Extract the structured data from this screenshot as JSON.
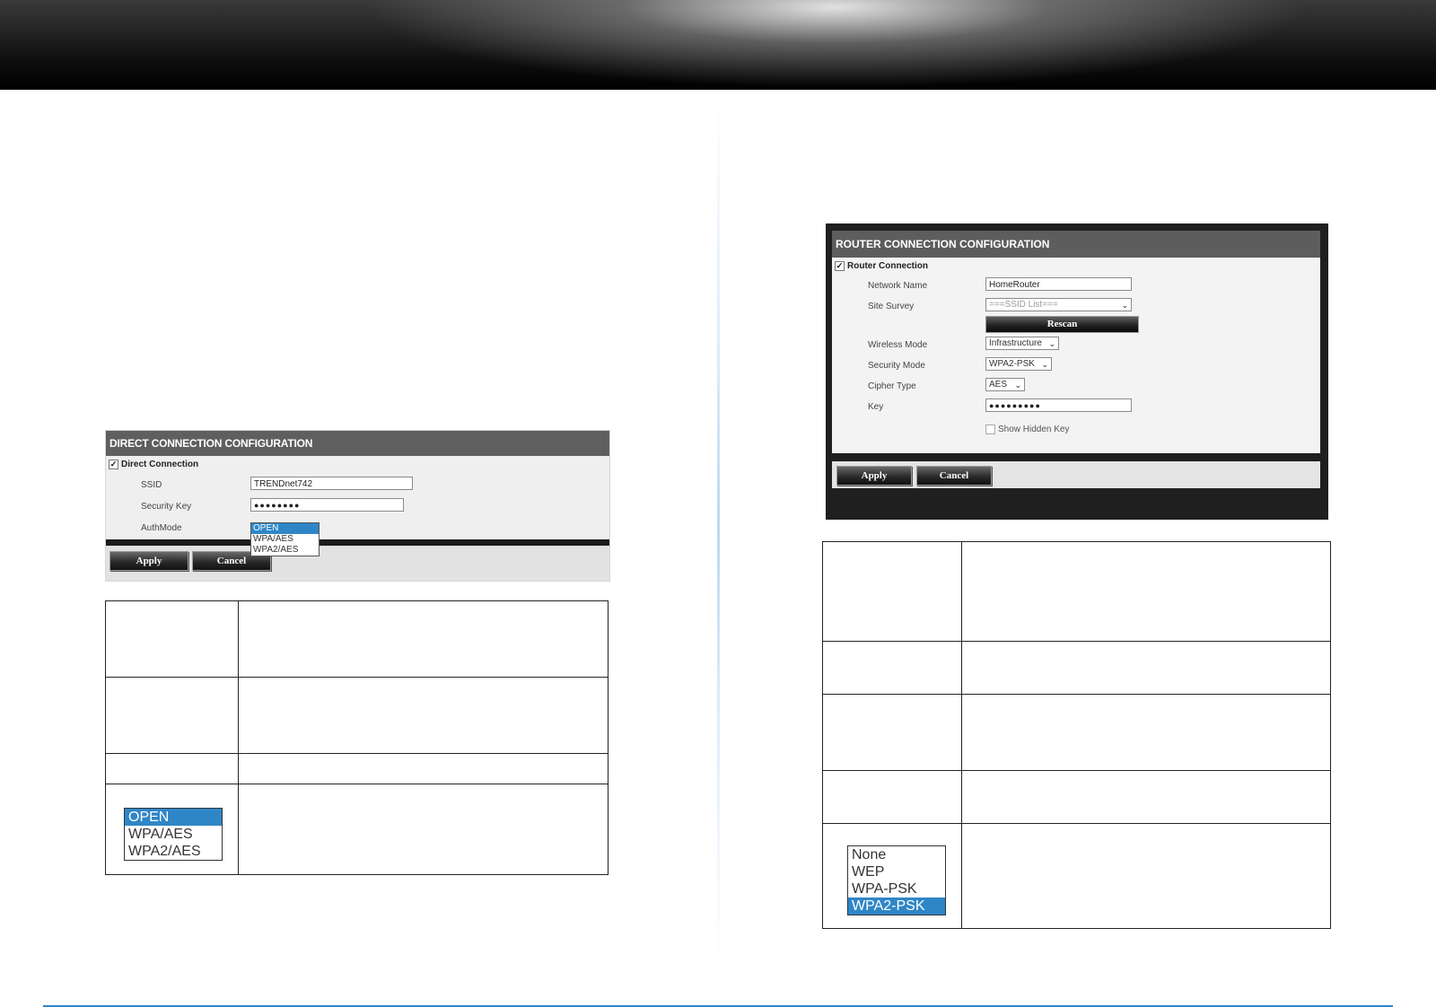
{
  "direct": {
    "title": "DIRECT CONNECTION CONFIGURATION",
    "checkbox_label": "Direct Connection",
    "checkbox_mark": "✓",
    "ssid_label": "SSID",
    "ssid_value": "TRENDnet742",
    "security_key_label": "Security Key",
    "security_key_value": "●●●●●●●●",
    "authmode_label": "AuthMode",
    "authmode_options": [
      "OPEN",
      "WPA/AES",
      "WPA2/AES"
    ],
    "authmode_selected": "OPEN",
    "apply_label": "Apply",
    "cancel_label": "Cancel"
  },
  "router": {
    "title": "ROUTER CONNECTION CONFIGURATION",
    "checkbox_label": "Router Connection",
    "checkbox_mark": "✓",
    "network_name_label": "Network Name",
    "network_name_value": "HomeRouter",
    "site_survey_label": "Site Survey",
    "site_survey_value": "===SSID List===",
    "rescan_label": "Rescan",
    "wireless_mode_label": "Wireless Mode",
    "wireless_mode_value": "Infrastructure",
    "security_mode_label": "Security Mode",
    "security_mode_value": "WPA2-PSK",
    "cipher_type_label": "Cipher Type",
    "cipher_type_value": "AES",
    "key_label": "Key",
    "key_value": "●●●●●●●●●",
    "show_hidden_key_label": "Show Hidden Key",
    "apply_label": "Apply",
    "cancel_label": "Cancel"
  },
  "direct_table_list": {
    "options": [
      "OPEN",
      "WPA/AES",
      "WPA2/AES"
    ],
    "selected": "OPEN"
  },
  "router_table_list": {
    "options": [
      "None",
      "WEP",
      "WPA-PSK",
      "WPA2-PSK"
    ],
    "selected": "WPA2-PSK"
  },
  "colors": {
    "selection_blue": "#2f86c7",
    "footer_line": "#2e84c8"
  }
}
